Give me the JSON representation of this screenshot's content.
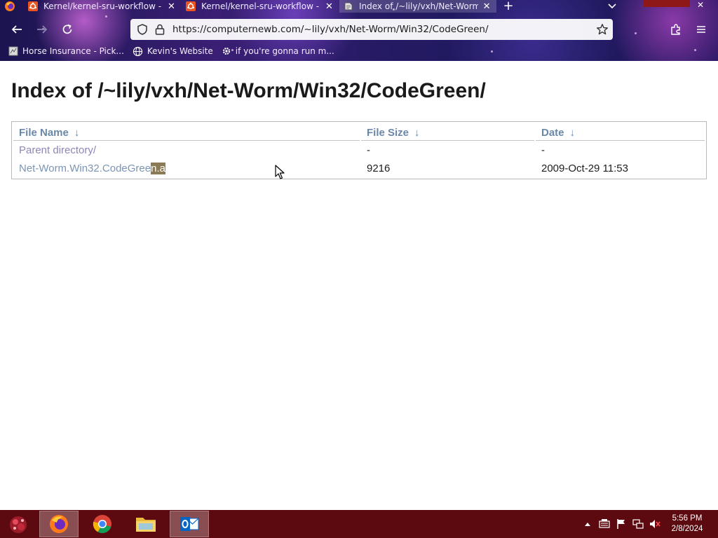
{
  "browser": {
    "tabs": [
      {
        "title": "Kernel/kernel-sru-workflow - U",
        "icon": "ubuntu-icon",
        "active": false
      },
      {
        "title": "Kernel/kernel-sru-workflow - U",
        "icon": "ubuntu-icon",
        "active": false
      },
      {
        "title": "Index of /~lily/vxh/Net-Worm",
        "icon": "page-icon",
        "active": true
      }
    ],
    "new_tab": "+",
    "close_glyph": "✕",
    "url": "https://computernewb.com/~lily/vxh/Net-Worm/Win32/CodeGreen/",
    "bookmarks": [
      {
        "label": "Horse Insurance - Pick...",
        "icon": "page-icon"
      },
      {
        "label": "Kevin's Website",
        "icon": "globe-icon"
      },
      {
        "label": "if you're gonna run m...",
        "icon": "gear-icon"
      }
    ]
  },
  "page": {
    "title": "Index of /~lily/vxh/Net-Worm/Win32/CodeGreen/",
    "columns": [
      {
        "label": "File Name",
        "sort": "↓"
      },
      {
        "label": "File Size",
        "sort": "↓"
      },
      {
        "label": "Date",
        "sort": "↓"
      }
    ],
    "rows": [
      {
        "name": "Parent directory/",
        "size": "-",
        "date": "-"
      },
      {
        "name_plain": "Net-Worm.Win32.CodeGree",
        "name_selected": "n.a",
        "size": "9216",
        "date": "2009-Oct-29 11:53"
      }
    ]
  },
  "taskbar": {
    "apps": [
      "firefox-icon",
      "chrome-icon",
      "file-explorer-icon",
      "outlook-icon"
    ],
    "time": "5:56 PM",
    "date": "2/8/2024"
  },
  "colors": {
    "link": "#7b95b4",
    "header": "#6a87a8",
    "selection": "#8a7a56",
    "taskbar": "#5c0a0f"
  }
}
